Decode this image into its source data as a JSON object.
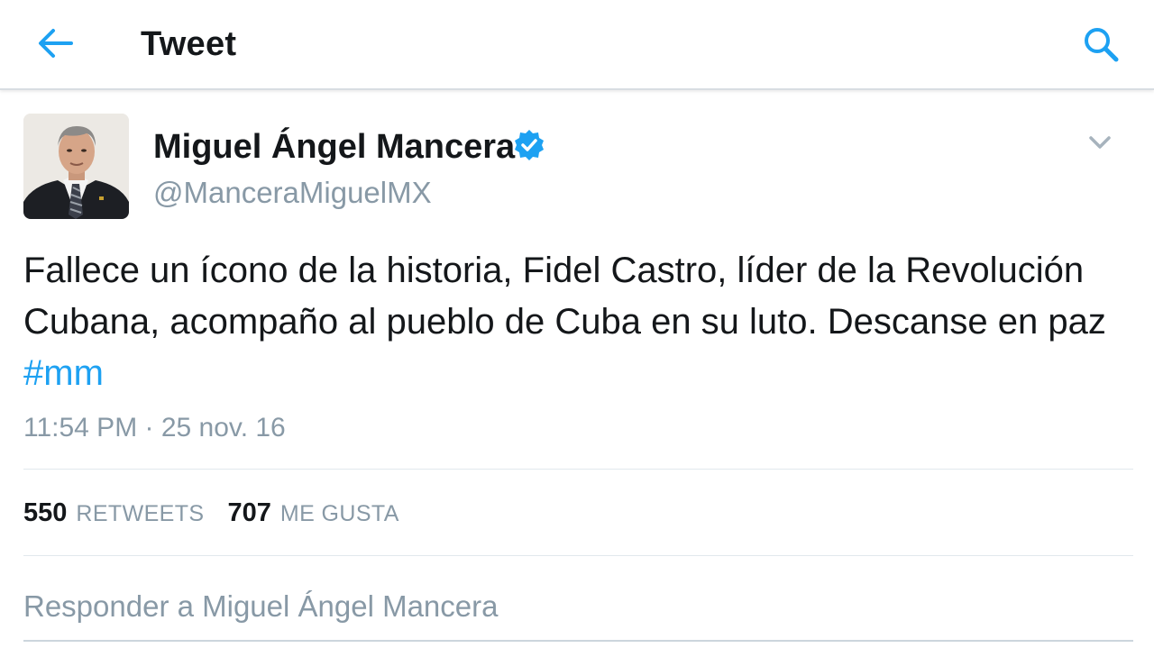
{
  "header": {
    "title": "Tweet",
    "back_icon": "arrow-left-icon",
    "search_icon": "search-icon",
    "accent_color": "#1da1f2"
  },
  "tweet": {
    "author_name": "Miguel Ángel Mancera",
    "verified": true,
    "handle": "@ManceraMiguelMX",
    "text": "Fallece un ícono de la historia, Fidel Castro, líder de la Revolución Cubana, acompaño al pueblo de Cuba en su luto. Descanse en paz ",
    "hashtag": "#mm",
    "timestamp": "11:54 PM · 25 nov. 16",
    "retweets_count": "550",
    "retweets_label": "RETWEETS",
    "likes_count": "707",
    "likes_label": "ME GUSTA"
  },
  "reply": {
    "placeholder": "Responder a Miguel Ángel Mancera"
  },
  "colors": {
    "text_primary": "#14171a",
    "text_secondary": "#8899a6",
    "divider": "#e1e8ed",
    "verified_badge": "#1da1f2"
  }
}
